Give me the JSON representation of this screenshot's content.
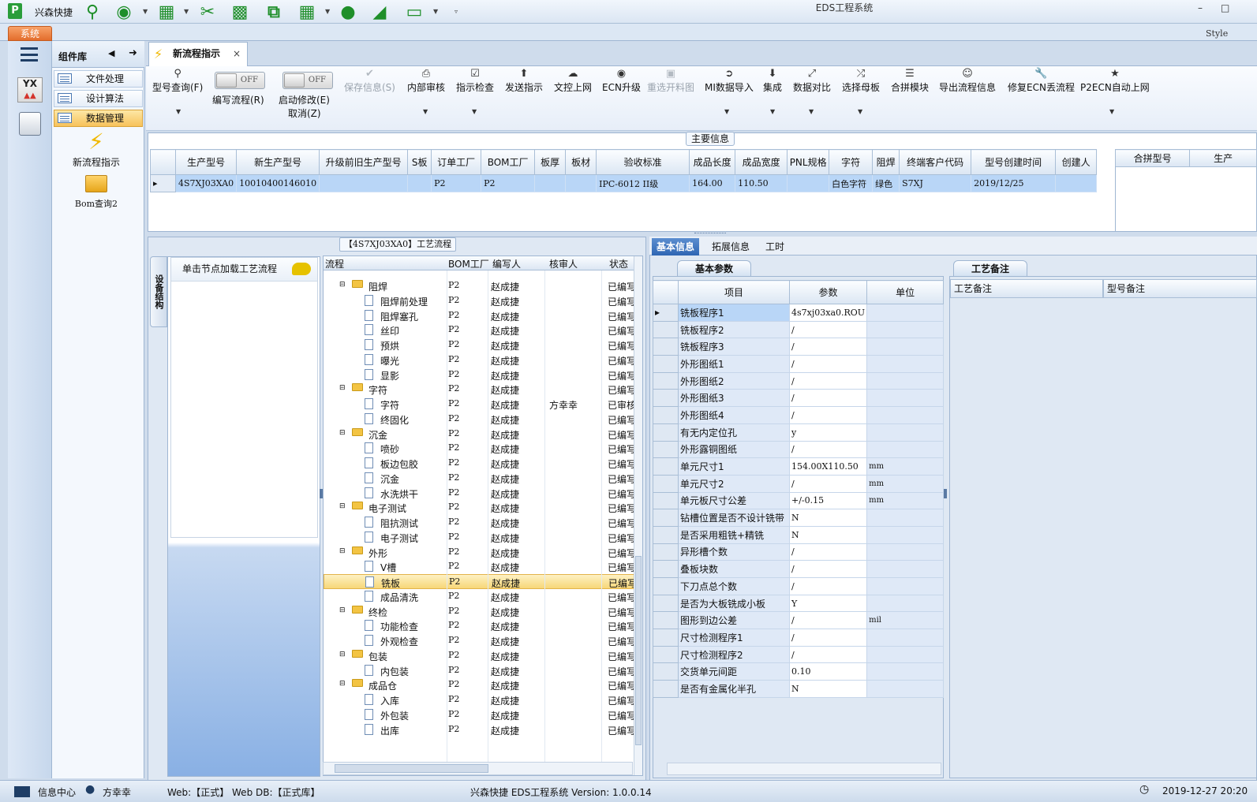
{
  "app": {
    "title": "EDS工程系统",
    "quick_label": "兴森快捷",
    "system_tab": "系统",
    "style_label": "Style",
    "minimize": "–",
    "maximize": "□",
    "accent": "#2f66b3",
    "system_tab_color": "#e36d2c",
    "quick_icon_color": "#1f8f2a"
  },
  "sidebar": {
    "header": "组件库",
    "items": [
      {
        "label": "文件处理"
      },
      {
        "label": "设计算法"
      },
      {
        "label": "数据管理",
        "active": true
      }
    ],
    "tools": [
      {
        "label": "新流程指示",
        "icon": "lightning-icon"
      },
      {
        "label": "Bom查询2",
        "icon": "folder-icon"
      }
    ]
  },
  "doc_tab": {
    "label": "新流程指示",
    "close": "×"
  },
  "toolbar": {
    "query": "型号查询(F)",
    "write_flow": "编写流程(R)",
    "start_modify": "启动修改(E)",
    "cancel": "取消(Z)",
    "toggle_off": "OFF",
    "save_info": "保存信息(S)",
    "buttons": [
      "内部审核",
      "指示检查",
      "发送指示",
      "文控上网",
      "ECN升级",
      "重选开料图",
      "MI数据导入",
      "集成",
      "数据对比",
      "选择母板",
      "合拼模块",
      "导出流程信息",
      "修复ECN丢流程",
      "P2ECN自动上网"
    ]
  },
  "main_info": {
    "group_label": "主要信息",
    "columns": [
      "生产型号",
      "新生产型号",
      "升级前旧生产型号",
      "S板",
      "订单工厂",
      "BOM工厂",
      "板厚",
      "板材",
      "验收标准",
      "成品长度",
      "成品宽度",
      "PNL规格",
      "字符",
      "阻焊",
      "终端客户代码",
      "型号创建时间",
      "创建人"
    ],
    "row": [
      "4S7XJ03XA0",
      "10010400146010",
      "",
      "",
      "P2",
      "P2",
      "",
      "",
      "IPC-6012 II级",
      "164.00",
      "110.50",
      "",
      "白色字符",
      "绿色",
      "S7XJ",
      "2019/12/25",
      ""
    ],
    "side_columns": [
      "合拼型号",
      "生产"
    ]
  },
  "flow": {
    "title": "【4S7XJ03XA0】工艺流程",
    "vertical_tab": "设备结构",
    "node_hint": "单击节点加载工艺流程",
    "columns": [
      "流程",
      "BOM工厂",
      "编写人",
      "核审人",
      "状态"
    ],
    "rows": [
      {
        "name": "阻焊",
        "level": 0,
        "bom": "P2",
        "writer": "赵成捷",
        "reviewer": "",
        "status": "已编写"
      },
      {
        "name": "阻焊前处理",
        "level": 1,
        "bom": "P2",
        "writer": "赵成捷",
        "reviewer": "",
        "status": "已编写"
      },
      {
        "name": "阻焊塞孔",
        "level": 1,
        "bom": "P2",
        "writer": "赵成捷",
        "reviewer": "",
        "status": "已编写"
      },
      {
        "name": "丝印",
        "level": 1,
        "bom": "P2",
        "writer": "赵成捷",
        "reviewer": "",
        "status": "已编写"
      },
      {
        "name": "预烘",
        "level": 1,
        "bom": "P2",
        "writer": "赵成捷",
        "reviewer": "",
        "status": "已编写"
      },
      {
        "name": "曝光",
        "level": 1,
        "bom": "P2",
        "writer": "赵成捷",
        "reviewer": "",
        "status": "已编写"
      },
      {
        "name": "显影",
        "level": 1,
        "bom": "P2",
        "writer": "赵成捷",
        "reviewer": "",
        "status": "已编写"
      },
      {
        "name": "字符",
        "level": 0,
        "bom": "P2",
        "writer": "赵成捷",
        "reviewer": "",
        "status": "已编写"
      },
      {
        "name": "字符",
        "level": 1,
        "bom": "P2",
        "writer": "赵成捷",
        "reviewer": "方幸幸",
        "status": "已审核"
      },
      {
        "name": "终固化",
        "level": 1,
        "bom": "P2",
        "writer": "赵成捷",
        "reviewer": "",
        "status": "已编写"
      },
      {
        "name": "沉金",
        "level": 0,
        "bom": "P2",
        "writer": "赵成捷",
        "reviewer": "",
        "status": "已编写"
      },
      {
        "name": "喷砂",
        "level": 1,
        "bom": "P2",
        "writer": "赵成捷",
        "reviewer": "",
        "status": "已编写"
      },
      {
        "name": "板边包胶",
        "level": 1,
        "bom": "P2",
        "writer": "赵成捷",
        "reviewer": "",
        "status": "已编写"
      },
      {
        "name": "沉金",
        "level": 1,
        "bom": "P2",
        "writer": "赵成捷",
        "reviewer": "",
        "status": "已编写"
      },
      {
        "name": "水洗烘干",
        "level": 1,
        "bom": "P2",
        "writer": "赵成捷",
        "reviewer": "",
        "status": "已编写"
      },
      {
        "name": "电子测试",
        "level": 0,
        "bom": "P2",
        "writer": "赵成捷",
        "reviewer": "",
        "status": "已编写"
      },
      {
        "name": "阻抗测试",
        "level": 1,
        "bom": "P2",
        "writer": "赵成捷",
        "reviewer": "",
        "status": "已编写"
      },
      {
        "name": "电子测试",
        "level": 1,
        "bom": "P2",
        "writer": "赵成捷",
        "reviewer": "",
        "status": "已编写"
      },
      {
        "name": "外形",
        "level": 0,
        "bom": "P2",
        "writer": "赵成捷",
        "reviewer": "",
        "status": "已编写"
      },
      {
        "name": "V槽",
        "level": 1,
        "bom": "P2",
        "writer": "赵成捷",
        "reviewer": "",
        "status": "已编写"
      },
      {
        "name": "铣板",
        "level": 1,
        "bom": "P2",
        "writer": "赵成捷",
        "reviewer": "",
        "status": "已编写",
        "selected": true
      },
      {
        "name": "成品清洗",
        "level": 1,
        "bom": "P2",
        "writer": "赵成捷",
        "reviewer": "",
        "status": "已编写"
      },
      {
        "name": "终检",
        "level": 0,
        "bom": "P2",
        "writer": "赵成捷",
        "reviewer": "",
        "status": "已编写"
      },
      {
        "name": "功能检查",
        "level": 1,
        "bom": "P2",
        "writer": "赵成捷",
        "reviewer": "",
        "status": "已编写"
      },
      {
        "name": "外观检查",
        "level": 1,
        "bom": "P2",
        "writer": "赵成捷",
        "reviewer": "",
        "status": "已编写"
      },
      {
        "name": "包装",
        "level": 0,
        "bom": "P2",
        "writer": "赵成捷",
        "reviewer": "",
        "status": "已编写"
      },
      {
        "name": "内包装",
        "level": 1,
        "bom": "P2",
        "writer": "赵成捷",
        "reviewer": "",
        "status": "已编写"
      },
      {
        "name": "成品仓",
        "level": 0,
        "bom": "P2",
        "writer": "赵成捷",
        "reviewer": "",
        "status": "已编写"
      },
      {
        "name": "入库",
        "level": 1,
        "bom": "P2",
        "writer": "赵成捷",
        "reviewer": "",
        "status": "已编写"
      },
      {
        "name": "外包装",
        "level": 1,
        "bom": "P2",
        "writer": "赵成捷",
        "reviewer": "",
        "status": "已编写"
      },
      {
        "name": "出库",
        "level": 1,
        "bom": "P2",
        "writer": "赵成捷",
        "reviewer": "",
        "status": "已编写"
      }
    ]
  },
  "detail": {
    "tabs": [
      "基本信息",
      "拓展信息",
      "工时"
    ],
    "sub_tab": "基本参数",
    "columns": [
      "项目",
      "参数",
      "单位"
    ],
    "rows": [
      {
        "item": "铣板程序1",
        "param": "4s7xj03xa0.ROU",
        "unit": ""
      },
      {
        "item": "铣板程序2",
        "param": "/",
        "unit": ""
      },
      {
        "item": "铣板程序3",
        "param": "/",
        "unit": ""
      },
      {
        "item": "外形图纸1",
        "param": "/",
        "unit": ""
      },
      {
        "item": "外形图纸2",
        "param": "/",
        "unit": ""
      },
      {
        "item": "外形图纸3",
        "param": "/",
        "unit": ""
      },
      {
        "item": "外形图纸4",
        "param": "/",
        "unit": ""
      },
      {
        "item": "有无内定位孔",
        "param": "y",
        "unit": ""
      },
      {
        "item": "外形露铜图纸",
        "param": "/",
        "unit": ""
      },
      {
        "item": "单元尺寸1",
        "param": "154.00X110.50",
        "unit": "mm"
      },
      {
        "item": "单元尺寸2",
        "param": "/",
        "unit": "mm"
      },
      {
        "item": "单元板尺寸公差",
        "param": "+/-0.15",
        "unit": "mm"
      },
      {
        "item": "钻槽位置是否不设计铣带",
        "param": "N",
        "unit": ""
      },
      {
        "item": "是否采用粗铣+精铣",
        "param": "N",
        "unit": ""
      },
      {
        "item": "异形槽个数",
        "param": "/",
        "unit": ""
      },
      {
        "item": "叠板块数",
        "param": "/",
        "unit": ""
      },
      {
        "item": "下刀点总个数",
        "param": "/",
        "unit": ""
      },
      {
        "item": "是否为大板铣成小板",
        "param": "Y",
        "unit": ""
      },
      {
        "item": "图形到边公差",
        "param": "/",
        "unit": "mil"
      },
      {
        "item": "尺寸检测程序1",
        "param": "/",
        "unit": ""
      },
      {
        "item": "尺寸检测程序2",
        "param": "/",
        "unit": ""
      },
      {
        "item": "交货单元间距",
        "param": "0.10",
        "unit": ""
      },
      {
        "item": "是否有金属化半孔",
        "param": "N",
        "unit": ""
      }
    ]
  },
  "remarks": {
    "tab": "工艺备注",
    "columns": [
      "工艺备注",
      "型号备注"
    ]
  },
  "status": {
    "info_center": "信息中心",
    "user": "方幸幸",
    "env": "Web:【正式】 Web DB:【正式库】",
    "version": "兴森快捷 EDS工程系统 Version: 1.0.0.14",
    "clock": "2019-12-27 20:20"
  }
}
